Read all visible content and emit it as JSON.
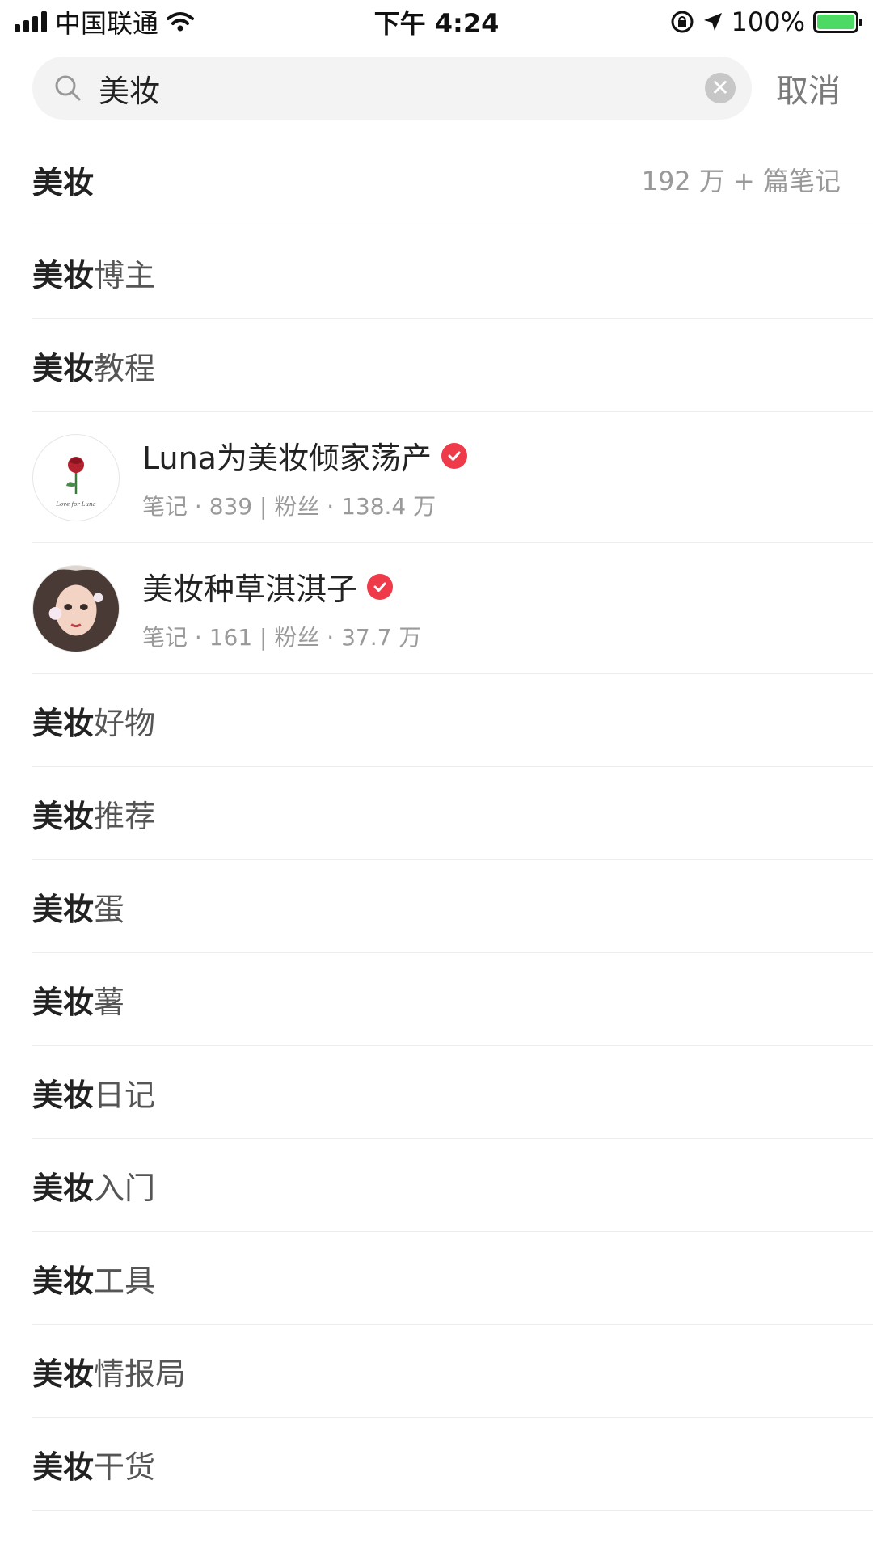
{
  "status_bar": {
    "carrier": "中国联通",
    "time": "下午 4:24",
    "battery": "100%",
    "battery_level": 1.0
  },
  "search": {
    "query": "美妆",
    "cancel_label": "取消"
  },
  "suggestions": [
    {
      "kw": "美妆",
      "rest": "",
      "count": "192 万 + 篇笔记"
    },
    {
      "kw": "美妆",
      "rest": "博主"
    },
    {
      "kw": "美妆",
      "rest": "教程"
    }
  ],
  "users": [
    {
      "name": "Luna为美妆倾家荡产",
      "stats": "笔记 · 839 | 粉丝 · 138.4 万",
      "avatar_caption": "Love for Luna",
      "verified": true
    },
    {
      "name": "美妆种草淇淇子",
      "stats": "笔记 · 161 | 粉丝 · 37.7 万",
      "verified": true
    }
  ],
  "more_suggestions": [
    {
      "kw": "美妆",
      "rest": "好物"
    },
    {
      "kw": "美妆",
      "rest": "推荐"
    },
    {
      "kw": "美妆",
      "rest": "蛋"
    },
    {
      "kw": "美妆",
      "rest": "薯"
    },
    {
      "kw": "美妆",
      "rest": "日记"
    },
    {
      "kw": "美妆",
      "rest": "入门"
    },
    {
      "kw": "美妆",
      "rest": "工具"
    },
    {
      "kw": "美妆",
      "rest": "情报局"
    },
    {
      "kw": "美妆",
      "rest": "干货"
    }
  ],
  "colors": {
    "verified": "#ef3a4a",
    "battery": "#4cd964"
  }
}
